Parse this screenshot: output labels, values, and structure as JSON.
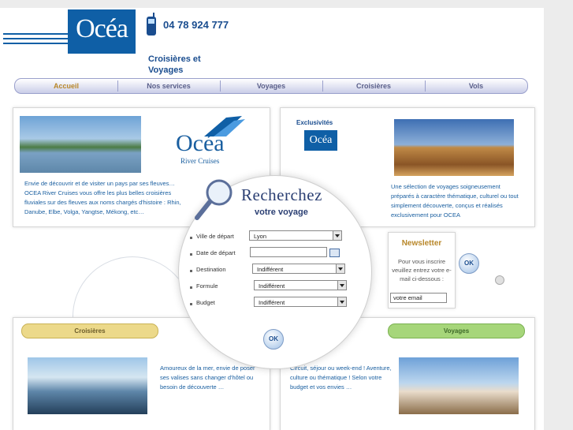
{
  "header": {
    "logo_text": "Océa",
    "phone": "04 78 924 777",
    "tagline": "Croisières et Voyages"
  },
  "nav": {
    "items": [
      "Accueil",
      "Nos services",
      "Voyages",
      "Croisières",
      "Vols"
    ],
    "active": "Accueil"
  },
  "river": {
    "logo_text": "Océa",
    "logo_sub": "River Cruises",
    "text": "Envie de découvrir et de visiter un pays par ses fleuves… OCEA River Cruises vous offre les plus belles croisières fluviales sur des fleuves aux noms chargés d'histoire : Rhin, Danube, Elbe, Volga, Yangtse, Mékong, etc…"
  },
  "exclusivites": {
    "title": "Exclusivités",
    "logo_text": "Océa",
    "text": "Une sélection de voyages soigneusement préparés à caractère thématique, culturel ou tout simplement découverte, conçus et réalisés exclusivement pour OCEA"
  },
  "search": {
    "title": "Recherchez",
    "subtitle": "votre voyage",
    "fields": [
      {
        "label": "Ville de départ",
        "value": "Lyon"
      },
      {
        "label": "Date de départ",
        "value": ""
      },
      {
        "label": "Destination",
        "value": "Indifférent"
      },
      {
        "label": "Formule",
        "value": "Indifférent"
      },
      {
        "label": "Budget",
        "value": "Indifférent"
      }
    ],
    "ok": "OK"
  },
  "newsletter": {
    "title": "Newsletter",
    "text": "Pour vous inscrire veuillez entrez votre e-mail ci-dessous :",
    "input_value": "votre email",
    "ok": "OK"
  },
  "croisieres": {
    "title": "Croisières",
    "text": "Amoureux de la mer, envie de poser ses valises sans changer d'hôtel ou besoin de découverte …"
  },
  "voyages": {
    "title": "Voyages",
    "text": "Circuit, séjour ou week-end ! Aventure, culture ou thématique ! Selon votre budget et vos envies …"
  },
  "colors": {
    "brand_blue": "#0f5fa6",
    "nav_active": "#b8872a",
    "croisieres_pill": "#ecd98a",
    "voyages_pill": "#a6d67a"
  }
}
